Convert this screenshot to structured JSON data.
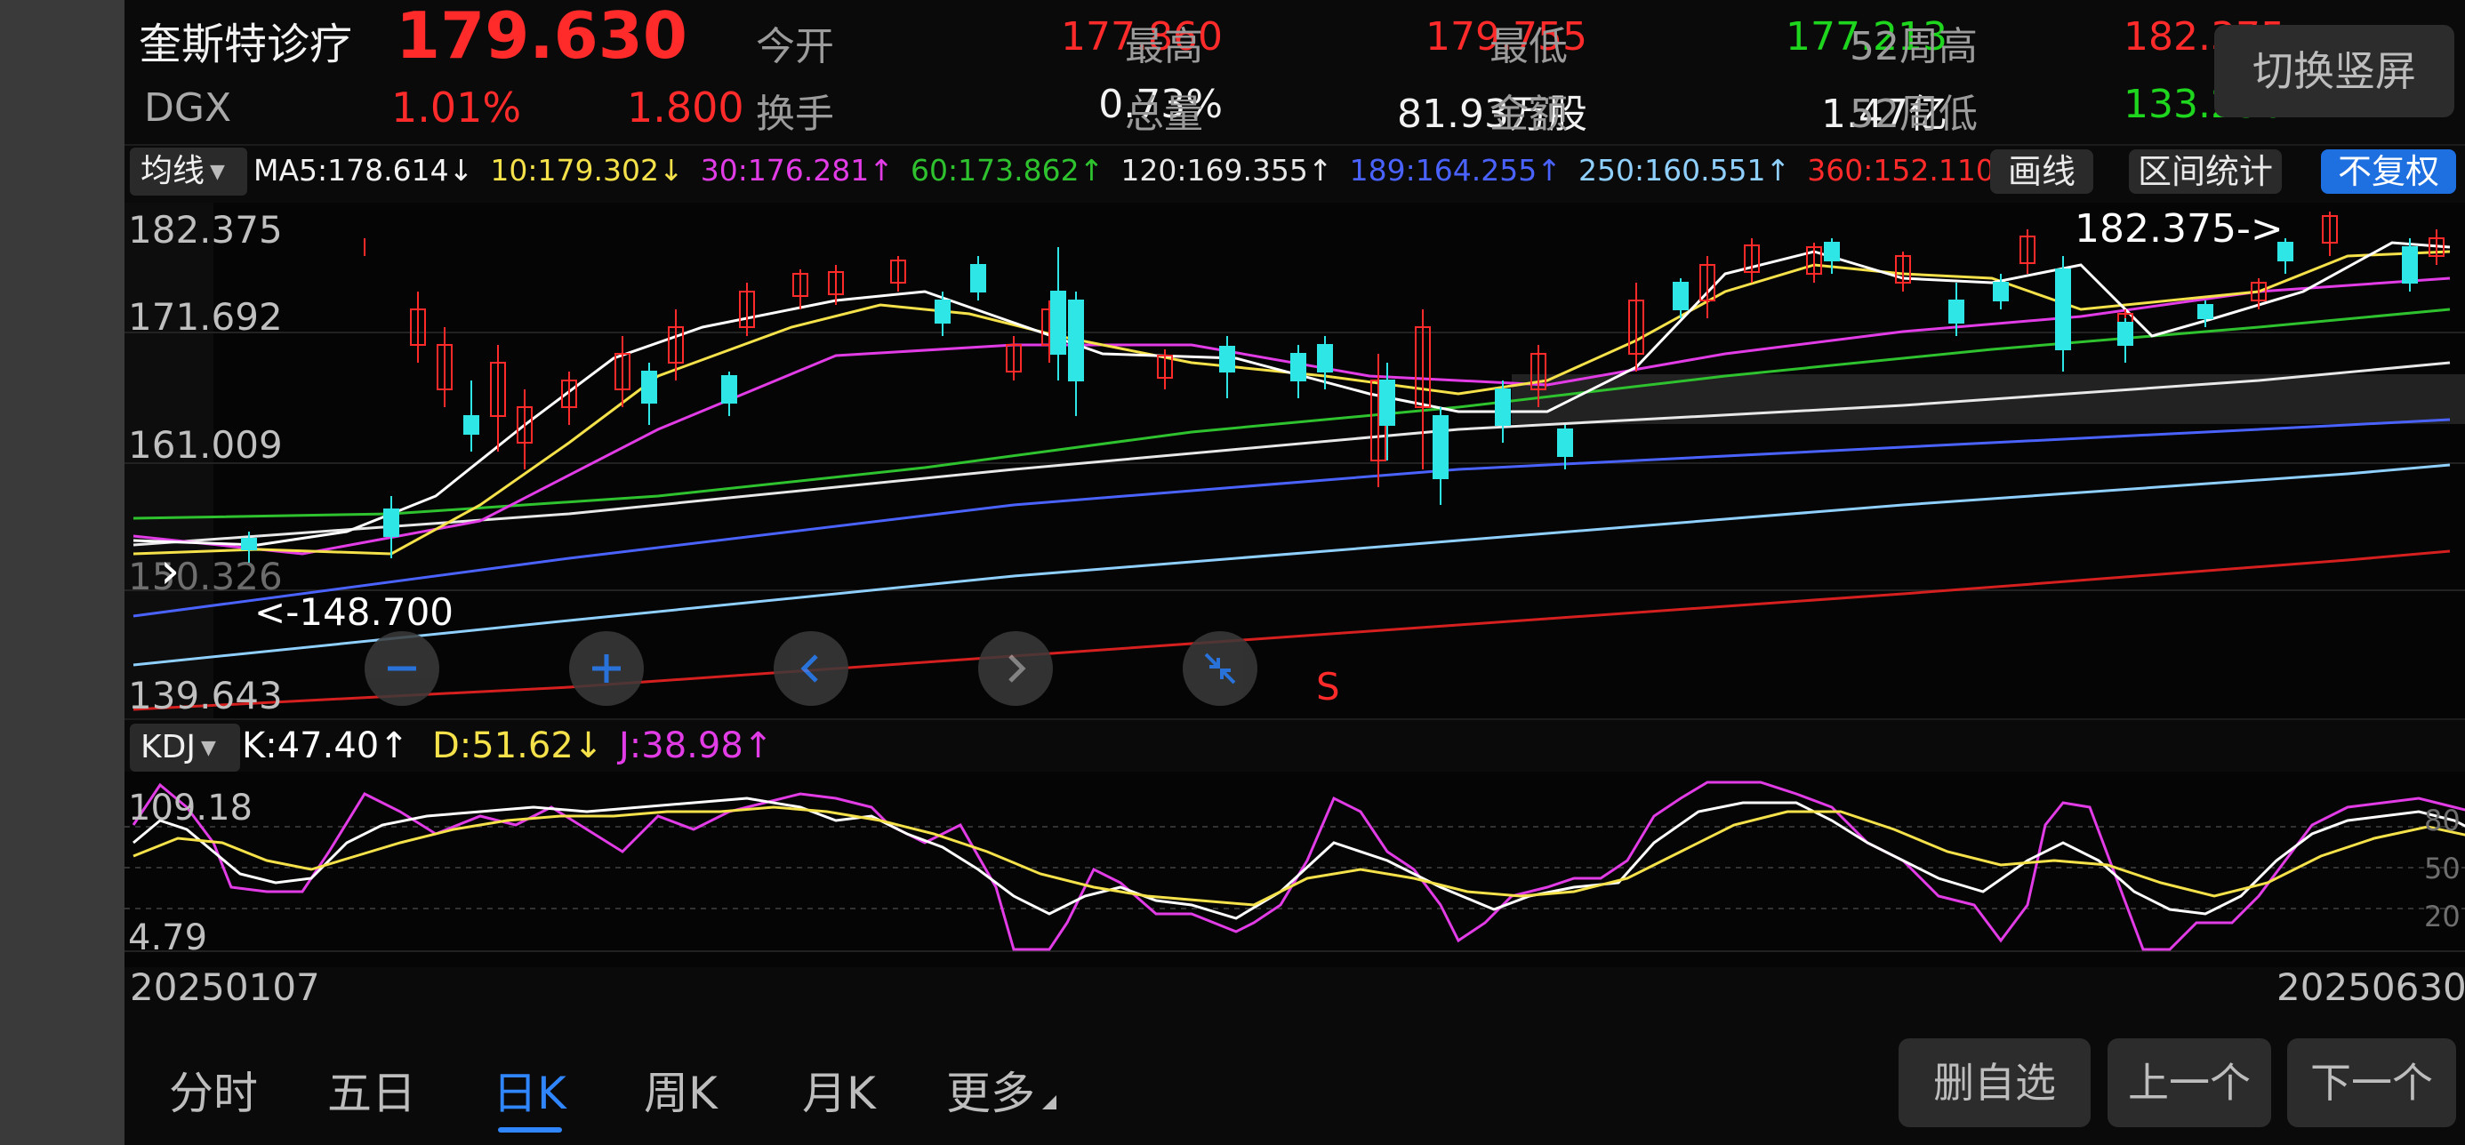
{
  "header": {
    "name": "奎斯特诊疗",
    "ticker": "DGX",
    "price": "179.630",
    "change_pct": "1.01%",
    "change_abs": "1.800",
    "open_label": "今开",
    "open": "177.860",
    "high_label": "最高",
    "high": "179.755",
    "low_label": "最低",
    "low": "177.213",
    "w52h_label": "52周高",
    "w52h": "182.375",
    "turnover_label": "换手",
    "turnover": "0.73%",
    "volume_label": "总量",
    "volume": "81.93万股",
    "amount_label": "金额",
    "amount": "1.47亿",
    "w52l_label": "52周低",
    "w52l": "133.250",
    "switch_btn": "切换竖屏"
  },
  "ma_bar": {
    "dropdown": "均线",
    "items": [
      {
        "text": "MA5:178.614↓",
        "color": "#f2f2f2"
      },
      {
        "text": "10:179.302↓",
        "color": "#f5e14a"
      },
      {
        "text": "30:176.281↑",
        "color": "#e23ce6"
      },
      {
        "text": "60:173.862↑",
        "color": "#2fc22f"
      },
      {
        "text": "120:169.355↑",
        "color": "#e8e8e8"
      },
      {
        "text": "189:164.255↑",
        "color": "#4a63ff"
      },
      {
        "text": "250:160.551↑",
        "color": "#8fd0ff"
      },
      {
        "text": "360:152.110↑",
        "color": "#ff2a2a"
      }
    ],
    "draw_btn": "画线",
    "range_btn": "区间统计",
    "adjust_btn": "不复权"
  },
  "price_axis": [
    "182.375",
    "171.692",
    "161.009",
    "150.326",
    "139.643"
  ],
  "annotations": {
    "high_marker": "182.375->",
    "low_marker": "<-148.700",
    "signal": "S"
  },
  "kdj_bar": {
    "dropdown": "KDJ",
    "k": "K:47.40↑",
    "d": "D:51.62↓",
    "j": "J:38.98↑"
  },
  "kdj_axis": {
    "top": "109.18",
    "bottom": "4.79",
    "r80": "80",
    "r50": "50",
    "r20": "20"
  },
  "dates": {
    "start": "20250107",
    "end": "20250630"
  },
  "tabs": [
    "分时",
    "五日",
    "日K",
    "周K",
    "月K",
    "更多"
  ],
  "active_tab": "日K",
  "bottom_buttons": {
    "delete": "删自选",
    "prev": "上一个",
    "next": "下一个"
  },
  "colors": {
    "up": "#ff2a2a",
    "down": "#1fd61f",
    "candle_down": "#2ee6e6",
    "accent": "#1e6fe0"
  }
}
